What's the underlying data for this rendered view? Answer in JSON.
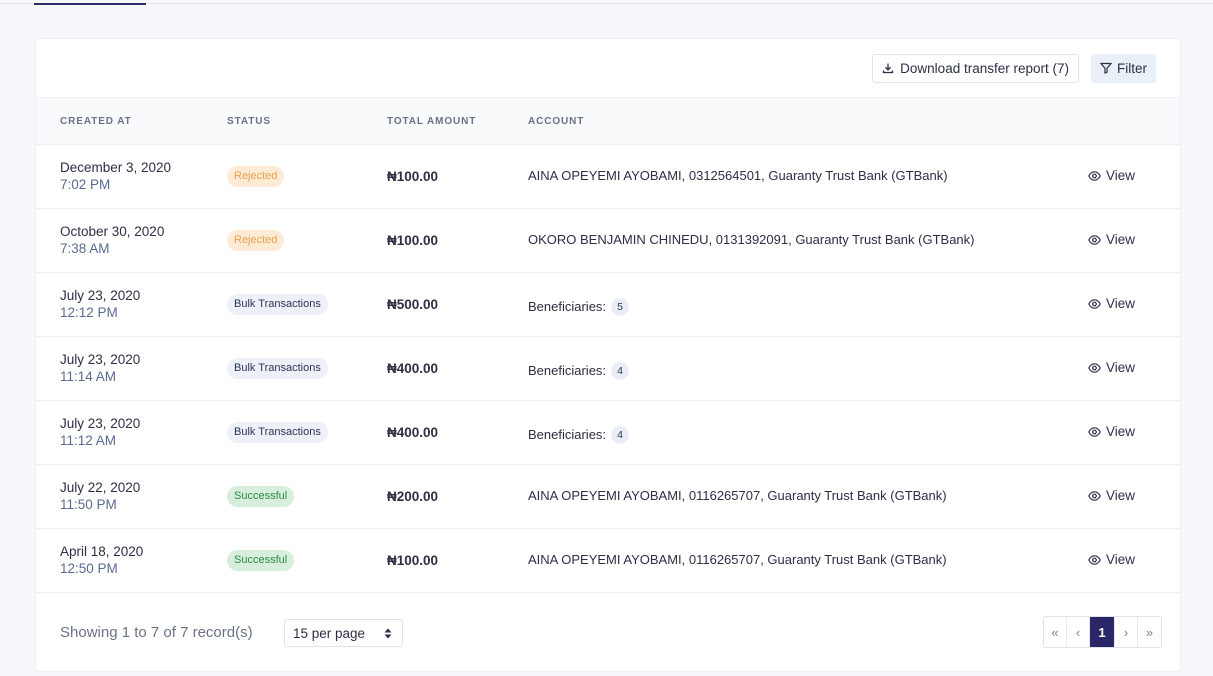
{
  "toolbar": {
    "download_label": "Download transfer report (7)",
    "filter_label": "Filter"
  },
  "columns": {
    "created_at": "CREATED AT",
    "status": "STATUS",
    "total_amount": "TOTAL AMOUNT",
    "account": "ACCOUNT"
  },
  "rows": [
    {
      "date": "December 3, 2020",
      "time": "7:02 PM",
      "status": "Rejected",
      "status_type": "rejected",
      "amount": "₦100.00",
      "account": "AINA OPEYEMI AYOBAMI, 0312564501, Guaranty Trust Bank (GTBank)",
      "beneficiaries": null,
      "view_label": "View"
    },
    {
      "date": "October 30, 2020",
      "time": "7:38 AM",
      "status": "Rejected",
      "status_type": "rejected",
      "amount": "₦100.00",
      "account": "OKORO BENJAMIN CHINEDU, 0131392091, Guaranty Trust Bank (GTBank)",
      "beneficiaries": null,
      "view_label": "View"
    },
    {
      "date": "July 23, 2020",
      "time": "12:12 PM",
      "status": "Bulk Transactions",
      "status_type": "bulk",
      "amount": "₦500.00",
      "account": "Beneficiaries:",
      "beneficiaries": "5",
      "view_label": "View"
    },
    {
      "date": "July 23, 2020",
      "time": "11:14 AM",
      "status": "Bulk Transactions",
      "status_type": "bulk",
      "amount": "₦400.00",
      "account": "Beneficiaries:",
      "beneficiaries": "4",
      "view_label": "View"
    },
    {
      "date": "July 23, 2020",
      "time": "11:12 AM",
      "status": "Bulk Transactions",
      "status_type": "bulk",
      "amount": "₦400.00",
      "account": "Beneficiaries:",
      "beneficiaries": "4",
      "view_label": "View"
    },
    {
      "date": "July 22, 2020",
      "time": "11:50 PM",
      "status": "Successful",
      "status_type": "success",
      "amount": "₦200.00",
      "account": "AINA OPEYEMI AYOBAMI, 0116265707, Guaranty Trust Bank (GTBank)",
      "beneficiaries": null,
      "view_label": "View"
    },
    {
      "date": "April 18, 2020",
      "time": "12:50 PM",
      "status": "Successful",
      "status_type": "success",
      "amount": "₦100.00",
      "account": "AINA OPEYEMI AYOBAMI, 0116265707, Guaranty Trust Bank (GTBank)",
      "beneficiaries": null,
      "view_label": "View"
    }
  ],
  "footer": {
    "showing_text": "Showing 1 to 7 of 7 record(s)",
    "per_page": "15 per page",
    "pager": {
      "first": "«",
      "prev": "‹",
      "current": "1",
      "next": "›",
      "last": "»"
    }
  },
  "icons": {
    "download": "download-icon",
    "filter": "filter-icon",
    "view": "eye-icon",
    "select": "sort-arrows-icon"
  },
  "colors": {
    "accent": "#2a2668",
    "rejected_bg": "#fdebd5",
    "rejected_text": "#e8a24a",
    "success_bg": "#d7eedd",
    "success_text": "#2e8a46",
    "bulk_bg": "#edf1f7"
  }
}
